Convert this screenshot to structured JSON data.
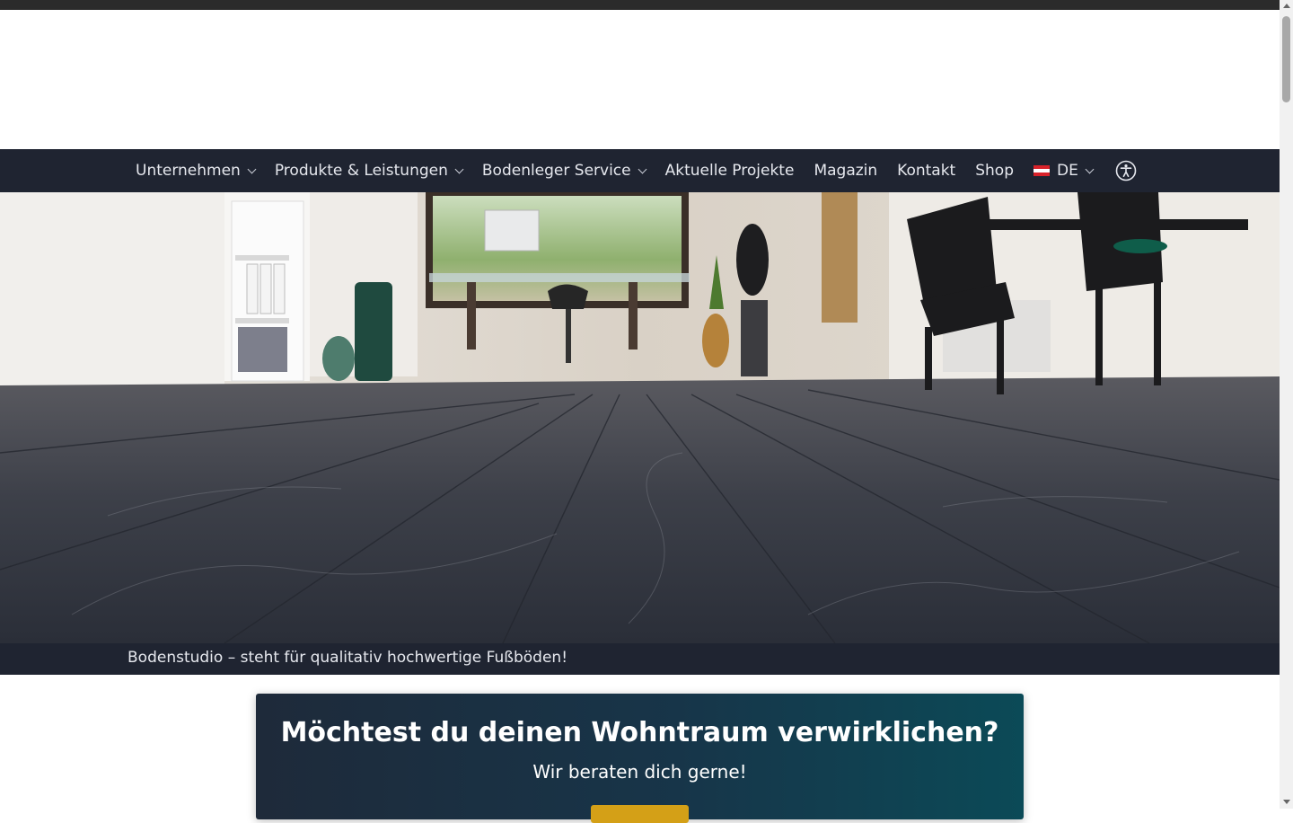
{
  "nav": {
    "items": [
      {
        "label": "Unternehmen",
        "dropdown": true
      },
      {
        "label": "Produkte & Leistungen",
        "dropdown": true
      },
      {
        "label": "Bodenleger Service",
        "dropdown": true
      },
      {
        "label": "Aktuelle Projekte",
        "dropdown": false
      },
      {
        "label": "Magazin",
        "dropdown": false
      },
      {
        "label": "Kontakt",
        "dropdown": false
      },
      {
        "label": "Shop",
        "dropdown": false
      }
    ],
    "language": "DE",
    "accessibility_icon": "accessibility-icon"
  },
  "hero": {
    "image": "office-interior-dark-wood-floor"
  },
  "caption": {
    "text": "Bodenstudio – steht für qualitativ hochwertige Fußböden!"
  },
  "cta": {
    "title": "Möchtest du deinen Wohntraum verwirklichen?",
    "subtitle": "Wir beraten dich gerne!"
  },
  "colors": {
    "nav_bg": "#1f2431",
    "cta_button": "#d4a017",
    "cta_gradient_end": "#0b4a57"
  }
}
